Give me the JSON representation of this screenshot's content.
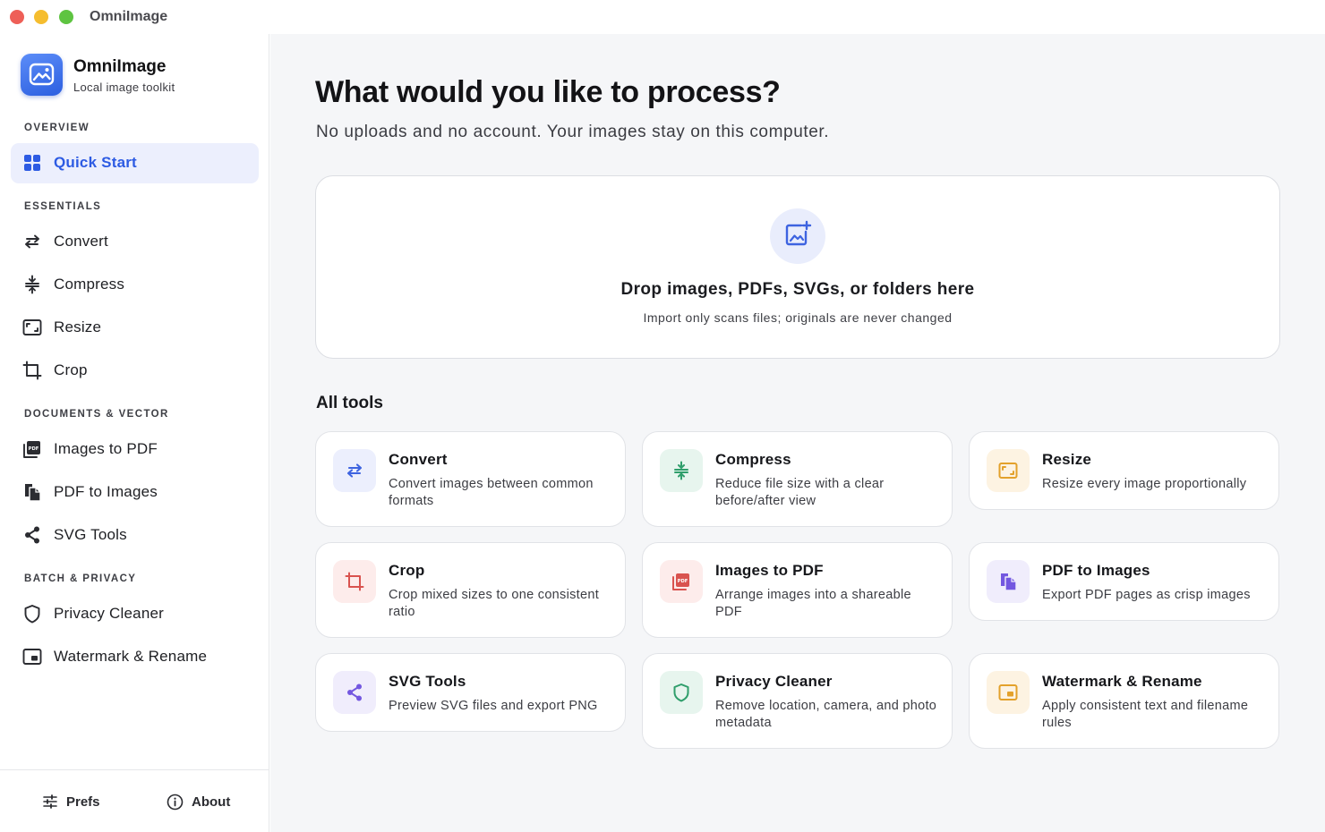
{
  "window": {
    "title": "OmniImage"
  },
  "brand": {
    "name": "OmniImage",
    "tagline": "Local image toolkit"
  },
  "sidebar": {
    "sections": [
      {
        "label": "OVERVIEW"
      },
      {
        "label": "ESSENTIALS"
      },
      {
        "label": "DOCUMENTS & VECTOR"
      },
      {
        "label": "BATCH & PRIVACY"
      }
    ],
    "items": [
      {
        "label": "Quick Start",
        "icon": "grid-icon",
        "active": true
      },
      {
        "label": "Convert",
        "icon": "swap-arrows-icon"
      },
      {
        "label": "Compress",
        "icon": "compress-icon"
      },
      {
        "label": "Resize",
        "icon": "resize-icon"
      },
      {
        "label": "Crop",
        "icon": "crop-icon"
      },
      {
        "label": "Images to PDF",
        "icon": "pdf-icon"
      },
      {
        "label": "PDF to Images",
        "icon": "pages-icon"
      },
      {
        "label": "SVG Tools",
        "icon": "share-nodes-icon"
      },
      {
        "label": "Privacy Cleaner",
        "icon": "shield-icon"
      },
      {
        "label": "Watermark & Rename",
        "icon": "watermark-icon"
      }
    ],
    "footer": {
      "prefs_label": "Prefs",
      "about_label": "About"
    }
  },
  "main": {
    "title": "What would you like to process?",
    "subtitle": "No uploads and no account. Your images stay on this computer.",
    "dropzone": {
      "title": "Drop images, PDFs, SVGs, or folders here",
      "subtitle": "Import only scans files; originals are never changed"
    },
    "tools_heading": "All tools",
    "tools": [
      {
        "title": "Convert",
        "desc": "Convert images between common formats",
        "icon": "swap-arrows-icon",
        "color": "#3d63e0",
        "bg": "#eceffd"
      },
      {
        "title": "Compress",
        "desc": "Reduce file size with a clear before/after view",
        "icon": "compress-icon",
        "color": "#2f9e6b",
        "bg": "#e7f5ee"
      },
      {
        "title": "Resize",
        "desc": "Resize every image proportionally",
        "icon": "resize-icon",
        "color": "#e3a12b",
        "bg": "#fdf3e2"
      },
      {
        "title": "Crop",
        "desc": "Crop mixed sizes to one consistent ratio",
        "icon": "crop-icon",
        "color": "#d9534f",
        "bg": "#fdeceb"
      },
      {
        "title": "Images to PDF",
        "desc": "Arrange images into a shareable PDF",
        "icon": "pdf-icon",
        "color": "#d9534f",
        "bg": "#fdeceb"
      },
      {
        "title": "PDF to Images",
        "desc": "Export PDF pages as crisp images",
        "icon": "pages-icon",
        "color": "#7357e0",
        "bg": "#f0edfc"
      },
      {
        "title": "SVG Tools",
        "desc": "Preview SVG files and export PNG",
        "icon": "share-nodes-icon",
        "color": "#7357e0",
        "bg": "#f0edfc"
      },
      {
        "title": "Privacy Cleaner",
        "desc": "Remove location, camera, and photo metadata",
        "icon": "shield-icon",
        "color": "#2f9e6b",
        "bg": "#e7f5ee"
      },
      {
        "title": "Watermark & Rename",
        "desc": "Apply consistent text and filename rules",
        "icon": "watermark-icon",
        "color": "#e3a12b",
        "bg": "#fdf3e2"
      }
    ]
  },
  "colors": {
    "accent": "#2d5be3",
    "active_bg": "#eceffd",
    "main_bg": "#f5f6f8"
  }
}
